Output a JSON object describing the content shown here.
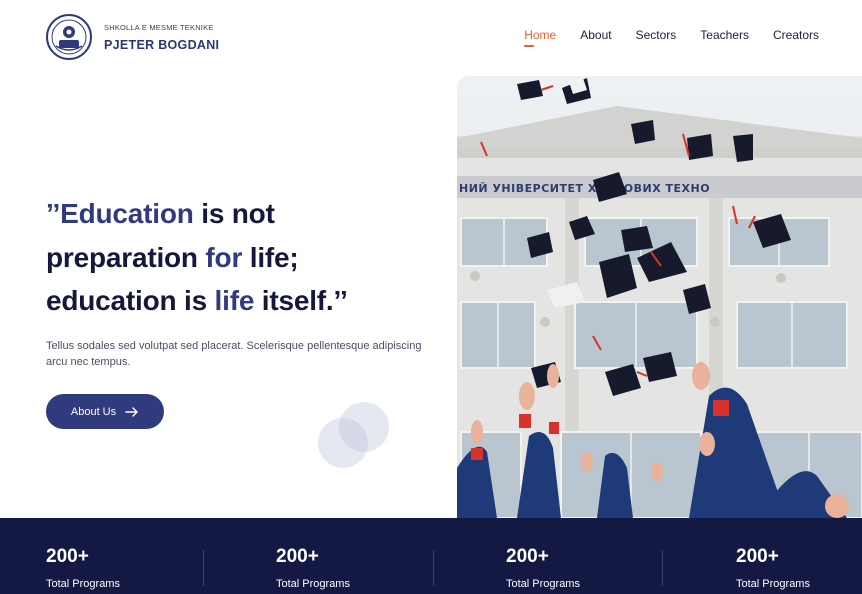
{
  "brand": {
    "subtitle": "SHKOLLA E MESME TEKNIKE",
    "name": "PJETER BOGDANI"
  },
  "nav": [
    {
      "label": "Home",
      "active": true
    },
    {
      "label": "About",
      "active": false
    },
    {
      "label": "Sectors",
      "active": false
    },
    {
      "label": "Teachers",
      "active": false
    },
    {
      "label": "Creators",
      "active": false
    }
  ],
  "hero": {
    "quote_open": "’’",
    "quote_w1": "Education",
    "quote_t1": " is not",
    "quote_t2": "preparation ",
    "quote_w2": "for",
    "quote_t3": " life;",
    "quote_t4": "education is ",
    "quote_w3": "life",
    "quote_t5": " itself.’’",
    "description": "Tellus sodales sed volutpat sed placerat. Scelerisque pellentesque adipiscing arcu nec tempus.",
    "button_label": "About Us",
    "building_sign": "НИЙ УНІВЕРСИТЕТ ХАРЧОВИХ ТЕХНО"
  },
  "stats": [
    {
      "value": "200+",
      "label": "Total Programs"
    },
    {
      "value": "200+",
      "label": "Total Programs"
    },
    {
      "value": "200+",
      "label": "Total Programs"
    },
    {
      "value": "200+",
      "label": "Total Programs"
    }
  ],
  "colors": {
    "accent": "#e4632a",
    "primary": "#2f3b7d",
    "dark_band": "#141943"
  }
}
